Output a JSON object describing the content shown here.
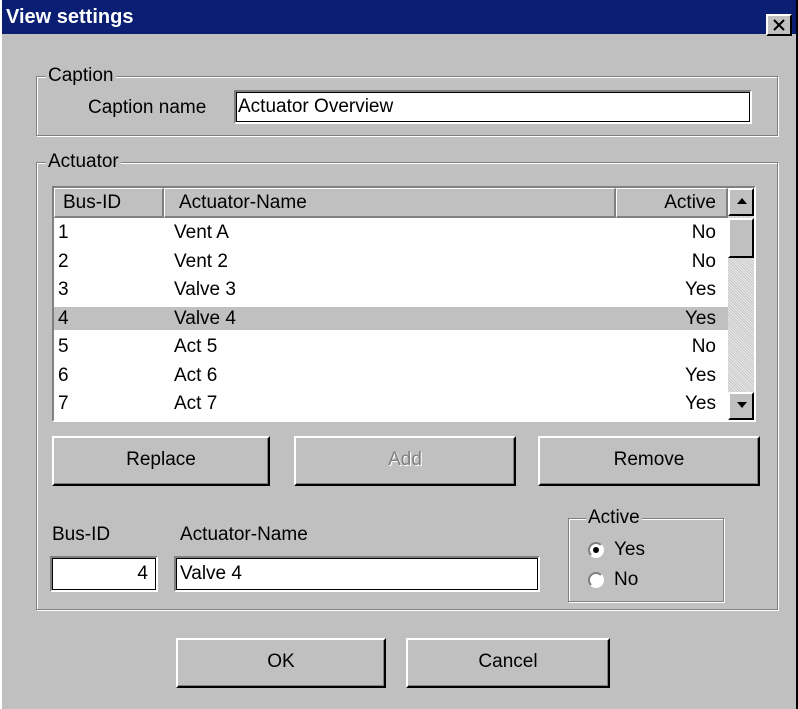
{
  "window": {
    "title": "View settings",
    "close_icon": "close-icon"
  },
  "caption_group": {
    "label": "Caption",
    "name_label": "Caption name",
    "name_value": "Actuator Overview"
  },
  "actuator_group": {
    "label": "Actuator",
    "columns": [
      "Bus-ID",
      "Actuator-Name",
      "Active"
    ],
    "rows": [
      {
        "bus_id": "1",
        "name": "Vent A",
        "active": "No"
      },
      {
        "bus_id": "2",
        "name": "Vent  2",
        "active": "No"
      },
      {
        "bus_id": "3",
        "name": "Valve 3",
        "active": "Yes"
      },
      {
        "bus_id": "4",
        "name": "Valve 4",
        "active": "Yes"
      },
      {
        "bus_id": "5",
        "name": "Act 5",
        "active": "No"
      },
      {
        "bus_id": "6",
        "name": "Act 6",
        "active": "Yes"
      },
      {
        "bus_id": "7",
        "name": "Act 7",
        "active": "Yes"
      }
    ],
    "selected_row_index": 3,
    "buttons": {
      "replace": "Replace",
      "add": "Add",
      "remove": "Remove"
    },
    "bus_id_label": "Bus-ID",
    "bus_id_value": "4",
    "name_label": "Actuator-Name",
    "name_value": "Valve 4",
    "active_group": {
      "label": "Active",
      "yes_label": "Yes",
      "no_label": "No",
      "selected": "Yes"
    }
  },
  "footer": {
    "ok": "OK",
    "cancel": "Cancel"
  },
  "colors": {
    "titlebar": "#0a1f73",
    "face": "#c0c0c0",
    "selection": "#c0c0c0"
  }
}
